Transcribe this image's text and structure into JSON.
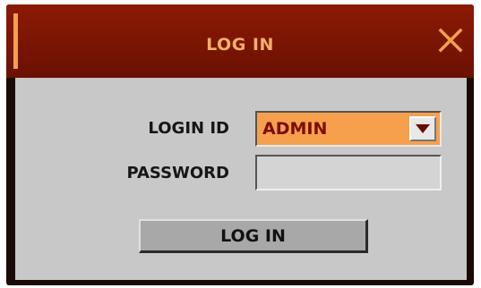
{
  "dialog": {
    "title": "LOG IN",
    "close_icon": "close-x-icon"
  },
  "form": {
    "login_id_label": "LOGIN ID",
    "login_id_value": "ADMIN",
    "password_label": "PASSWORD",
    "password_value": "",
    "dropdown_icon": "triangle-down-icon"
  },
  "actions": {
    "login_button_label": "LOG IN"
  },
  "colors": {
    "title_bar": "#7a1504",
    "title_text": "#f2b068",
    "accent": "#f0a24a",
    "panel": "#c8c8c8",
    "selected_field": "#f6a04e",
    "selected_text": "#7a0e00"
  }
}
